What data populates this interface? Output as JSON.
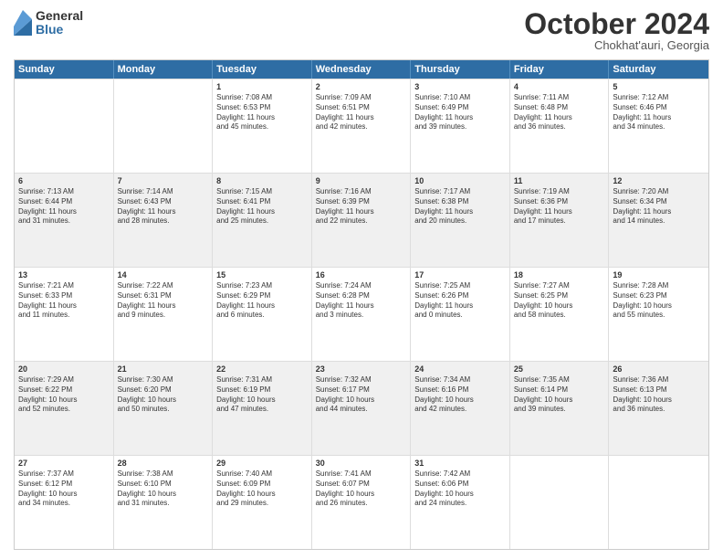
{
  "logo": {
    "general": "General",
    "blue": "Blue"
  },
  "title": "October 2024",
  "subtitle": "Chokhat'auri, Georgia",
  "headers": [
    "Sunday",
    "Monday",
    "Tuesday",
    "Wednesday",
    "Thursday",
    "Friday",
    "Saturday"
  ],
  "weeks": [
    [
      {
        "day": "",
        "info": ""
      },
      {
        "day": "",
        "info": ""
      },
      {
        "day": "1",
        "info": "Sunrise: 7:08 AM\nSunset: 6:53 PM\nDaylight: 11 hours\nand 45 minutes."
      },
      {
        "day": "2",
        "info": "Sunrise: 7:09 AM\nSunset: 6:51 PM\nDaylight: 11 hours\nand 42 minutes."
      },
      {
        "day": "3",
        "info": "Sunrise: 7:10 AM\nSunset: 6:49 PM\nDaylight: 11 hours\nand 39 minutes."
      },
      {
        "day": "4",
        "info": "Sunrise: 7:11 AM\nSunset: 6:48 PM\nDaylight: 11 hours\nand 36 minutes."
      },
      {
        "day": "5",
        "info": "Sunrise: 7:12 AM\nSunset: 6:46 PM\nDaylight: 11 hours\nand 34 minutes."
      }
    ],
    [
      {
        "day": "6",
        "info": "Sunrise: 7:13 AM\nSunset: 6:44 PM\nDaylight: 11 hours\nand 31 minutes."
      },
      {
        "day": "7",
        "info": "Sunrise: 7:14 AM\nSunset: 6:43 PM\nDaylight: 11 hours\nand 28 minutes."
      },
      {
        "day": "8",
        "info": "Sunrise: 7:15 AM\nSunset: 6:41 PM\nDaylight: 11 hours\nand 25 minutes."
      },
      {
        "day": "9",
        "info": "Sunrise: 7:16 AM\nSunset: 6:39 PM\nDaylight: 11 hours\nand 22 minutes."
      },
      {
        "day": "10",
        "info": "Sunrise: 7:17 AM\nSunset: 6:38 PM\nDaylight: 11 hours\nand 20 minutes."
      },
      {
        "day": "11",
        "info": "Sunrise: 7:19 AM\nSunset: 6:36 PM\nDaylight: 11 hours\nand 17 minutes."
      },
      {
        "day": "12",
        "info": "Sunrise: 7:20 AM\nSunset: 6:34 PM\nDaylight: 11 hours\nand 14 minutes."
      }
    ],
    [
      {
        "day": "13",
        "info": "Sunrise: 7:21 AM\nSunset: 6:33 PM\nDaylight: 11 hours\nand 11 minutes."
      },
      {
        "day": "14",
        "info": "Sunrise: 7:22 AM\nSunset: 6:31 PM\nDaylight: 11 hours\nand 9 minutes."
      },
      {
        "day": "15",
        "info": "Sunrise: 7:23 AM\nSunset: 6:29 PM\nDaylight: 11 hours\nand 6 minutes."
      },
      {
        "day": "16",
        "info": "Sunrise: 7:24 AM\nSunset: 6:28 PM\nDaylight: 11 hours\nand 3 minutes."
      },
      {
        "day": "17",
        "info": "Sunrise: 7:25 AM\nSunset: 6:26 PM\nDaylight: 11 hours\nand 0 minutes."
      },
      {
        "day": "18",
        "info": "Sunrise: 7:27 AM\nSunset: 6:25 PM\nDaylight: 10 hours\nand 58 minutes."
      },
      {
        "day": "19",
        "info": "Sunrise: 7:28 AM\nSunset: 6:23 PM\nDaylight: 10 hours\nand 55 minutes."
      }
    ],
    [
      {
        "day": "20",
        "info": "Sunrise: 7:29 AM\nSunset: 6:22 PM\nDaylight: 10 hours\nand 52 minutes."
      },
      {
        "day": "21",
        "info": "Sunrise: 7:30 AM\nSunset: 6:20 PM\nDaylight: 10 hours\nand 50 minutes."
      },
      {
        "day": "22",
        "info": "Sunrise: 7:31 AM\nSunset: 6:19 PM\nDaylight: 10 hours\nand 47 minutes."
      },
      {
        "day": "23",
        "info": "Sunrise: 7:32 AM\nSunset: 6:17 PM\nDaylight: 10 hours\nand 44 minutes."
      },
      {
        "day": "24",
        "info": "Sunrise: 7:34 AM\nSunset: 6:16 PM\nDaylight: 10 hours\nand 42 minutes."
      },
      {
        "day": "25",
        "info": "Sunrise: 7:35 AM\nSunset: 6:14 PM\nDaylight: 10 hours\nand 39 minutes."
      },
      {
        "day": "26",
        "info": "Sunrise: 7:36 AM\nSunset: 6:13 PM\nDaylight: 10 hours\nand 36 minutes."
      }
    ],
    [
      {
        "day": "27",
        "info": "Sunrise: 7:37 AM\nSunset: 6:12 PM\nDaylight: 10 hours\nand 34 minutes."
      },
      {
        "day": "28",
        "info": "Sunrise: 7:38 AM\nSunset: 6:10 PM\nDaylight: 10 hours\nand 31 minutes."
      },
      {
        "day": "29",
        "info": "Sunrise: 7:40 AM\nSunset: 6:09 PM\nDaylight: 10 hours\nand 29 minutes."
      },
      {
        "day": "30",
        "info": "Sunrise: 7:41 AM\nSunset: 6:07 PM\nDaylight: 10 hours\nand 26 minutes."
      },
      {
        "day": "31",
        "info": "Sunrise: 7:42 AM\nSunset: 6:06 PM\nDaylight: 10 hours\nand 24 minutes."
      },
      {
        "day": "",
        "info": ""
      },
      {
        "day": "",
        "info": ""
      }
    ]
  ]
}
